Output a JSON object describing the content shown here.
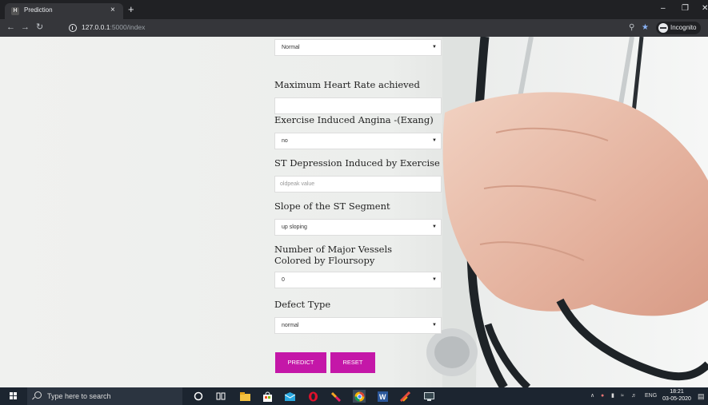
{
  "browser": {
    "tab_title": "Prediction",
    "tab_close": "×",
    "new_tab": "+",
    "url_host": "127.0.0.1",
    "url_path": ":5000/index",
    "incognito_label": "Incognito"
  },
  "form": {
    "thal_selected": "Normal",
    "max_hr_label": "Maximum Heart Rate achieved",
    "max_hr_value": "",
    "exang_label": "Exercise Induced Angina -(Exang)",
    "exang_selected": "no",
    "oldpeak_label": "ST Depression Induced by Exercise",
    "oldpeak_placeholder": "oldpeak value",
    "slope_label": "Slope of the ST Segment",
    "slope_selected": "up sloping",
    "vessels_label": "Number of Major Vessels Colored by Floursopy",
    "vessels_selected": "0",
    "defect_label": "Defect Type",
    "defect_selected": "normal",
    "predict_label": "PREDICT",
    "reset_label": "RESET"
  },
  "taskbar": {
    "search_placeholder": "Type here to search",
    "language": "ENG",
    "time": "18:21",
    "date": "03-05-2020"
  },
  "colors": {
    "button": "#c417a8",
    "chrome_dark": "#202124",
    "taskbar": "#1c2530"
  },
  "icons": [
    "windows-start-icon",
    "search-icon",
    "cortana-icon",
    "task-view-icon",
    "file-explorer-icon",
    "store-icon",
    "mail-icon",
    "opera-icon",
    "paint-icon",
    "chrome-icon",
    "word-icon",
    "app-icon",
    "monitor-icon"
  ]
}
